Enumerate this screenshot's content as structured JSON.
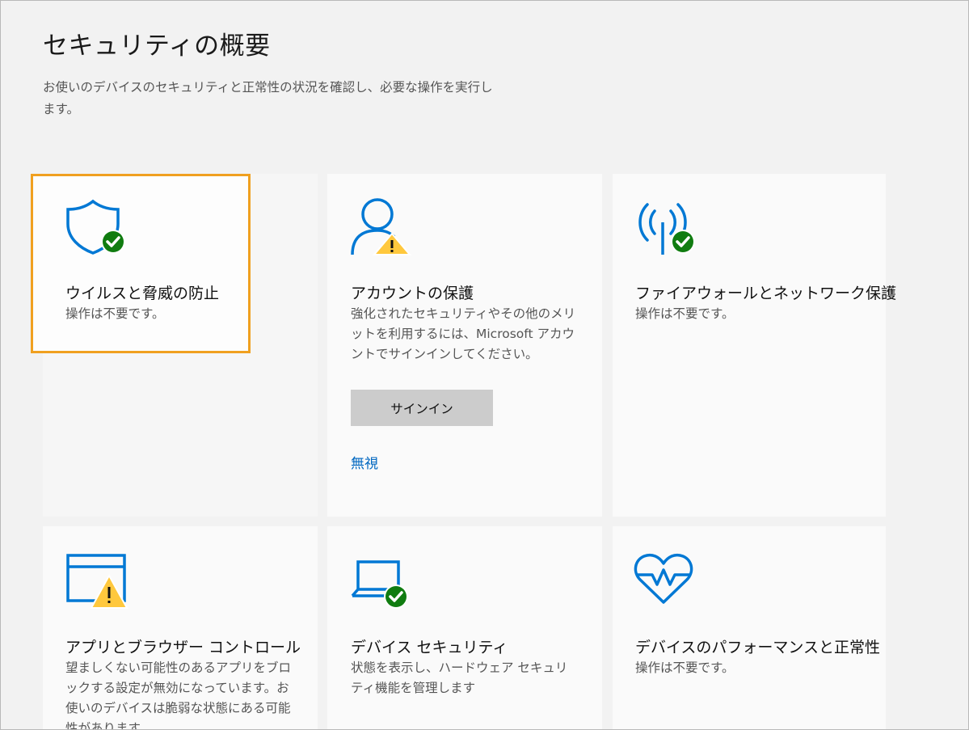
{
  "header": {
    "title": "セキュリティの概要",
    "description": "お使いのデバイスのセキュリティと正常性の状況を確認し、必要な操作を実行します。"
  },
  "cards": [
    {
      "id": "virus",
      "title": "ウイルスと脅威の防止",
      "text": "操作は不要です。",
      "icon": "shield-check-icon",
      "status": "ok"
    },
    {
      "id": "account",
      "title": "アカウントの保護",
      "text": "強化されたセキュリティやその他のメリットを利用するには、Microsoft アカウントでサインインしてください。",
      "icon": "person-warning-icon",
      "status": "warning",
      "button_label": "サインイン",
      "link_label": "無視"
    },
    {
      "id": "firewall",
      "title": "ファイアウォールとネットワーク保護",
      "text": "操作は不要です。",
      "icon": "antenna-check-icon",
      "status": "ok"
    },
    {
      "id": "app-browser",
      "title": "アプリとブラウザー コントロール",
      "text": "望ましくない可能性のあるアプリをブロックする設定が無効になっています。お使いのデバイスは脆弱な状態にある可能性があります。",
      "icon": "browser-warning-icon",
      "status": "warning"
    },
    {
      "id": "device-security",
      "title": "デバイス セキュリティ",
      "text": "状態を表示し、ハードウェア セキュリティ機能を管理します",
      "icon": "laptop-check-icon",
      "status": "ok"
    },
    {
      "id": "performance",
      "title": "デバイスのパフォーマンスと正常性",
      "text": "操作は不要です。",
      "icon": "heart-pulse-icon",
      "status": "ok"
    }
  ],
  "colors": {
    "accent_blue": "#0078d4",
    "link_blue": "#0067c0",
    "ok_green": "#107c10",
    "warning_yellow": "#ffc83d",
    "highlight_orange": "#f0a020"
  }
}
